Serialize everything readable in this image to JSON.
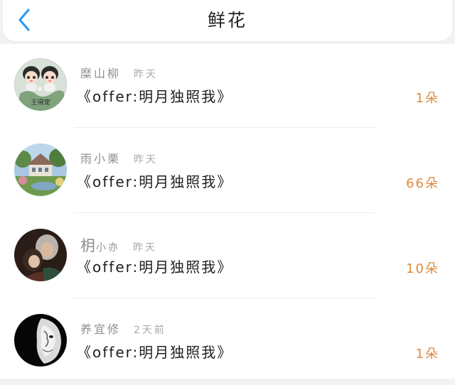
{
  "header": {
    "title": "鲜花",
    "back_icon": "chevron-left-icon",
    "accent": "#2e9bf0"
  },
  "records": [
    {
      "name": "糜山柳",
      "time": "昨天",
      "book": "《offer:明月独照我》",
      "count": "1朵",
      "avatar": "cartoon-couple-avatar",
      "avatar_text": "王得宠"
    },
    {
      "name": "雨小栗",
      "time": "昨天",
      "book": "《offer:明月独照我》",
      "count": "66朵",
      "avatar": "garden-house-avatar"
    },
    {
      "name_big": "枂",
      "name": "小亦",
      "time": "昨天",
      "book": "《offer:明月独照我》",
      "count": "10朵",
      "avatar": "couple-photo-avatar"
    },
    {
      "name": "养宜修",
      "time": "2天前",
      "book": "《offer:明月独照我》",
      "count": "1朵",
      "avatar": "masked-face-avatar"
    }
  ],
  "colors": {
    "count": "#e0883a",
    "meta": "#8f8f8f",
    "text": "#1e1e1e"
  }
}
